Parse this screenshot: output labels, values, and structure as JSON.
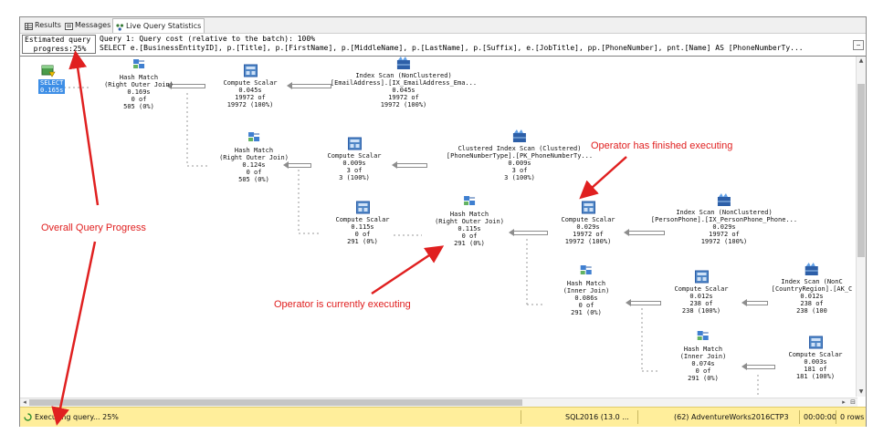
{
  "tabs": [
    {
      "label": "Results",
      "icon": "grid-icon"
    },
    {
      "label": "Messages",
      "icon": "messages-icon"
    },
    {
      "label": "Live Query Statistics",
      "icon": "live-stats-icon",
      "active": true
    }
  ],
  "header": {
    "progress_line1": "Estimated query",
    "progress_line2": "  progress:25%",
    "query_line1": "Query 1: Query cost (relative to the batch): 100%",
    "query_line2": "SELECT e.[BusinessEntityID], p.[Title], p.[FirstName], p.[MiddleName], p.[LastName], p.[Suffix], e.[JobTitle], pp.[PhoneNumber], pnt.[Name] AS [PhoneNumberTy..."
  },
  "plan": {
    "select_node": {
      "name": "SELECT",
      "time": "0.165s"
    },
    "nodes": [
      {
        "id": "hm1",
        "icon": "hash-match-icon",
        "lines": [
          "Hash Match",
          "(Right Outer Join)",
          "0.169s",
          "0 of",
          "505 (0%)"
        ]
      },
      {
        "id": "cs1",
        "icon": "compute-scalar-icon",
        "lines": [
          "Compute Scalar",
          "0.045s",
          "19972 of",
          "19972 (100%)"
        ]
      },
      {
        "id": "is1",
        "icon": "index-scan-icon",
        "lines": [
          "Index Scan (NonClustered)",
          "[EmailAddress].[IX_EmailAddress_Ema...",
          "0.045s",
          "19972 of",
          "19972 (100%)"
        ]
      },
      {
        "id": "hm2",
        "icon": "hash-match-icon",
        "lines": [
          "Hash Match",
          "(Right Outer Join)",
          "0.124s",
          "0 of",
          "505 (0%)"
        ]
      },
      {
        "id": "cs2",
        "icon": "compute-scalar-icon",
        "lines": [
          "Compute Scalar",
          "0.009s",
          "3 of",
          "3 (100%)"
        ]
      },
      {
        "id": "cis1",
        "icon": "clustered-index-scan-icon",
        "lines": [
          "Clustered Index Scan (Clustered)",
          "[PhoneNumberType].[PK_PhoneNumberTy...",
          "0.009s",
          "3 of",
          "3 (100%)"
        ]
      },
      {
        "id": "cs3",
        "icon": "compute-scalar-icon",
        "lines": [
          "Compute Scalar",
          "0.115s",
          "0 of",
          "291 (0%)"
        ]
      },
      {
        "id": "hm3",
        "icon": "hash-match-icon",
        "lines": [
          "Hash Match",
          "(Right Outer Join)",
          "0.115s",
          "0 of",
          "291 (0%)"
        ]
      },
      {
        "id": "cs4",
        "icon": "compute-scalar-icon",
        "lines": [
          "Compute Scalar",
          "0.029s",
          "19972 of",
          "19972 (100%)"
        ]
      },
      {
        "id": "is2",
        "icon": "index-scan-icon",
        "lines": [
          "Index Scan (NonClustered)",
          "[PersonPhone].[IX_PersonPhone_Phone...",
          "0.029s",
          "19972 of",
          "19972 (100%)"
        ]
      },
      {
        "id": "hm4",
        "icon": "hash-match-icon",
        "lines": [
          "Hash Match",
          "(Inner Join)",
          "0.086s",
          "0 of",
          "291 (0%)"
        ]
      },
      {
        "id": "cs5",
        "icon": "compute-scalar-icon",
        "lines": [
          "Compute Scalar",
          "0.012s",
          "238 of",
          "238 (100%)"
        ]
      },
      {
        "id": "is3",
        "icon": "index-scan-icon",
        "lines": [
          "Index Scan (NonC",
          "[CountryRegion].[AK_C",
          "0.012s",
          "238 of",
          "238 (100"
        ]
      },
      {
        "id": "hm5",
        "icon": "hash-match-icon",
        "lines": [
          "Hash Match",
          "(Inner Join)",
          "0.074s",
          "0 of",
          "291 (0%)"
        ]
      },
      {
        "id": "cs6",
        "icon": "compute-scalar-icon",
        "lines": [
          "Compute Scalar",
          "0.003s",
          "181 of",
          "181 (100%)"
        ]
      }
    ]
  },
  "annotations": {
    "finished": "Operator has finished executing",
    "overall": "Overall Query Progress",
    "executing": "Operator is currently executing"
  },
  "status": {
    "executing": "Executing query... 25%",
    "server": "SQL2016 (13.0 ...",
    "user": "(62)",
    "database": "AdventureWorks2016CTP3",
    "time": "00:00:00",
    "rows": "0 rows"
  },
  "colors": {
    "status_bar": "#ffee9b",
    "annotation": "#e02020",
    "selection": "#3d8ee6"
  }
}
